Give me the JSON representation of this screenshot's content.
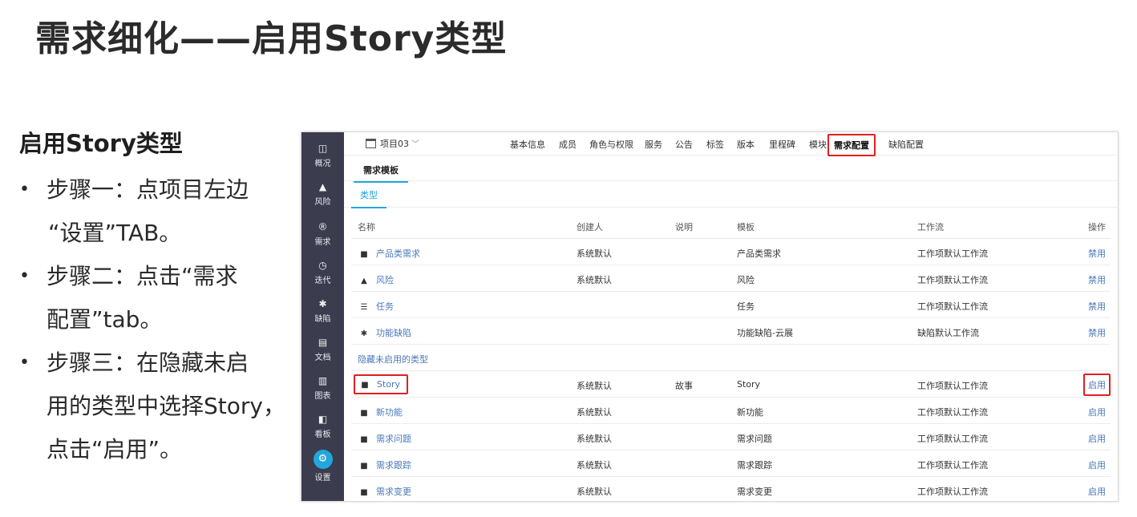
{
  "slide": {
    "title": "需求细化——启用Story类型",
    "subhead": "启用Story类型",
    "steps": [
      {
        "lines": [
          "步骤一：点项目左边",
          "“设置”TAB。"
        ]
      },
      {
        "lines": [
          "步骤二：点击“需求",
          "配置”tab。"
        ]
      },
      {
        "lines": [
          "步骤三：在隐藏未启",
          "用的类型中选择Story，",
          "点击“启用”。"
        ]
      }
    ]
  },
  "sidebar": {
    "items": [
      {
        "label": "概况",
        "icon": "overview-icon",
        "glyph": "◫"
      },
      {
        "label": "风险",
        "icon": "warning-icon",
        "glyph": "▲"
      },
      {
        "label": "需求",
        "icon": "requirement-icon",
        "glyph": "®"
      },
      {
        "label": "迭代",
        "icon": "iteration-icon",
        "glyph": "◷"
      },
      {
        "label": "缺陷",
        "icon": "bug-icon",
        "glyph": "✱"
      },
      {
        "label": "文档",
        "icon": "document-icon",
        "glyph": "▤"
      },
      {
        "label": "图表",
        "icon": "chart-icon",
        "glyph": "▥"
      },
      {
        "label": "看板",
        "icon": "board-icon",
        "glyph": "◧"
      },
      {
        "label": "设置",
        "icon": "settings-icon",
        "glyph": "⚙"
      }
    ]
  },
  "topbar": {
    "project": "项目03",
    "tabs": [
      "基本信息",
      "成员",
      "角色与权限",
      "服务",
      "公告",
      "标签",
      "版本",
      "里程碑",
      "模块",
      "需求配置",
      "缺陷配置"
    ]
  },
  "subtab": "需求模板",
  "typetab": "类型",
  "table": {
    "columns": [
      "名称",
      "创建人",
      "说明",
      "模板",
      "工作流",
      "操作"
    ],
    "enabled_rows": [
      {
        "icon": "bookmark-icon",
        "glyph": "■",
        "name": "产品类需求",
        "creator": "系统默认",
        "desc": "",
        "template": "产品类需求",
        "workflow": "工作项默认工作流",
        "action": "禁用"
      },
      {
        "icon": "warning-icon",
        "glyph": "▲",
        "name": "风险",
        "creator": "系统默认",
        "desc": "",
        "template": "风险",
        "workflow": "工作项默认工作流",
        "action": "禁用"
      },
      {
        "icon": "task-icon",
        "glyph": "☰",
        "name": "任务",
        "creator": "",
        "desc": "",
        "template": "任务",
        "workflow": "工作项默认工作流",
        "action": "禁用"
      },
      {
        "icon": "bug-icon",
        "glyph": "✱",
        "name": "功能缺陷",
        "creator": "",
        "desc": "",
        "template": "功能缺陷-云展",
        "workflow": "缺陷默认工作流",
        "action": "禁用"
      }
    ],
    "hidden_label": "隐藏未启用的类型",
    "hidden_rows": [
      {
        "icon": "bookmark-icon",
        "glyph": "■",
        "name": "Story",
        "creator": "系统默认",
        "desc": "故事",
        "template": "Story",
        "workflow": "工作项默认工作流",
        "action": "启用"
      },
      {
        "icon": "bookmark-icon",
        "glyph": "■",
        "name": "新功能",
        "creator": "系统默认",
        "desc": "",
        "template": "新功能",
        "workflow": "工作项默认工作流",
        "action": "启用"
      },
      {
        "icon": "bookmark-icon",
        "glyph": "■",
        "name": "需求问题",
        "creator": "系统默认",
        "desc": "",
        "template": "需求问题",
        "workflow": "工作项默认工作流",
        "action": "启用"
      },
      {
        "icon": "bookmark-icon",
        "glyph": "■",
        "name": "需求跟踪",
        "creator": "系统默认",
        "desc": "",
        "template": "需求跟踪",
        "workflow": "工作项默认工作流",
        "action": "启用"
      },
      {
        "icon": "bookmark-icon",
        "glyph": "■",
        "name": "需求变更",
        "creator": "系统默认",
        "desc": "",
        "template": "需求变更",
        "workflow": "工作项默认工作流",
        "action": "启用"
      }
    ]
  },
  "colors": {
    "sidebar_bg": "#3c3c4f",
    "accent": "#22a7dc",
    "link": "#4a78b8",
    "highlight_box": "#e02020"
  }
}
